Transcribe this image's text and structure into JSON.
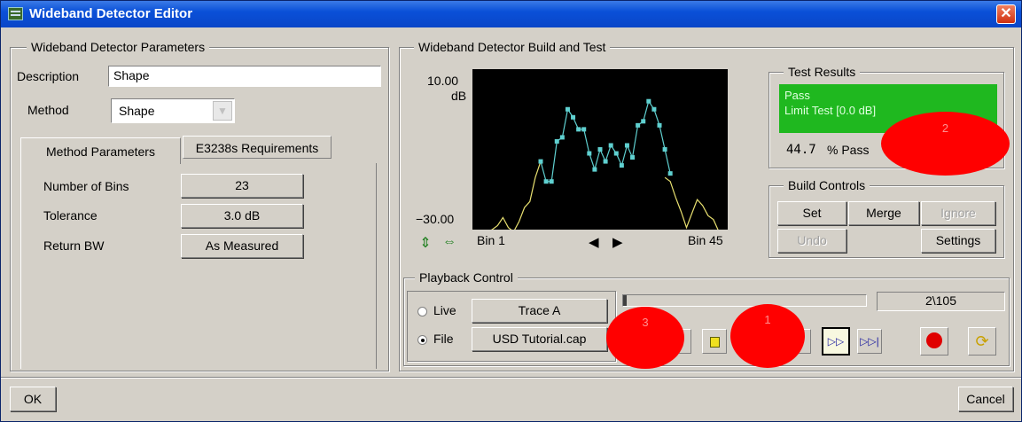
{
  "window": {
    "title": "Wideband Detector Editor"
  },
  "params": {
    "legend": "Wideband Detector Parameters",
    "description_label": "Description",
    "description_value": "Shape",
    "method_label": "Method",
    "method_value": "Shape",
    "tabs": [
      "Method Parameters",
      "E3238s Requirements"
    ],
    "rows": [
      {
        "label": "Number of Bins",
        "value": "23"
      },
      {
        "label": "Tolerance",
        "value": "3.0 dB"
      },
      {
        "label": "Return BW",
        "value": "As Measured"
      }
    ]
  },
  "build": {
    "legend": "Wideband Detector Build and Test",
    "y_top": "10.00",
    "y_unit": "dB",
    "y_bottom": "−30.00",
    "x_left": "Bin 1",
    "x_right": "Bin 45"
  },
  "chart_data": {
    "type": "line",
    "x": [
      1,
      2,
      3,
      4,
      5,
      6,
      7,
      8,
      9,
      10,
      11,
      12,
      13,
      14,
      15,
      16,
      17,
      18,
      19,
      20,
      21,
      22,
      23,
      24,
      25,
      26,
      27,
      28,
      29,
      30,
      31,
      32,
      33,
      34,
      35,
      36,
      37,
      38,
      39,
      40,
      41,
      42,
      43,
      44,
      45
    ],
    "series": [
      {
        "name": "trace",
        "color": "#e8e070",
        "y": [
          -31,
          -30.5,
          -30,
          -29,
          -27,
          -29.5,
          -30.5,
          -28,
          -24.5,
          -23,
          -17,
          -13,
          null,
          null,
          null,
          null,
          null,
          null,
          null,
          null,
          null,
          null,
          null,
          null,
          null,
          null,
          null,
          null,
          null,
          null,
          null,
          null,
          null,
          null,
          -17,
          -18,
          -22,
          -25.5,
          -29.5,
          -26,
          -22.5,
          -24,
          -26.5,
          -27.5,
          -30.5
        ]
      },
      {
        "name": "detector",
        "color": "#5fd0d0",
        "y": [
          null,
          null,
          null,
          null,
          null,
          null,
          null,
          null,
          null,
          null,
          null,
          -13,
          -18,
          -18,
          -8,
          -7,
          0,
          -2,
          -5,
          -5,
          -11,
          -15,
          -10,
          -13,
          -9,
          -11,
          -14,
          -9,
          -12,
          -4,
          -3,
          2,
          0,
          -4,
          -10,
          -16,
          null,
          null,
          null,
          null,
          null,
          null,
          null,
          null,
          null
        ]
      }
    ],
    "ylim": [
      -30,
      10
    ],
    "xlim": [
      1,
      45
    ]
  },
  "results": {
    "legend": "Test Results",
    "status": "Pass",
    "detail": "Limit Test [0.0 dB]",
    "percent": "44.7",
    "percent_suffix": "% Pass"
  },
  "build_controls": {
    "legend": "Build Controls",
    "set": "Set",
    "merge": "Merge",
    "ignore": "Ignore",
    "undo": "Undo",
    "settings": "Settings"
  },
  "playback": {
    "legend": "Playback Control",
    "live_label": "Live",
    "live_source": "Trace A",
    "file_label": "File",
    "file_source": "USD Tutorial.cap",
    "counter": "2\\105"
  },
  "markers": [
    "1",
    "2",
    "3"
  ],
  "footer": {
    "ok": "OK",
    "cancel": "Cancel"
  }
}
